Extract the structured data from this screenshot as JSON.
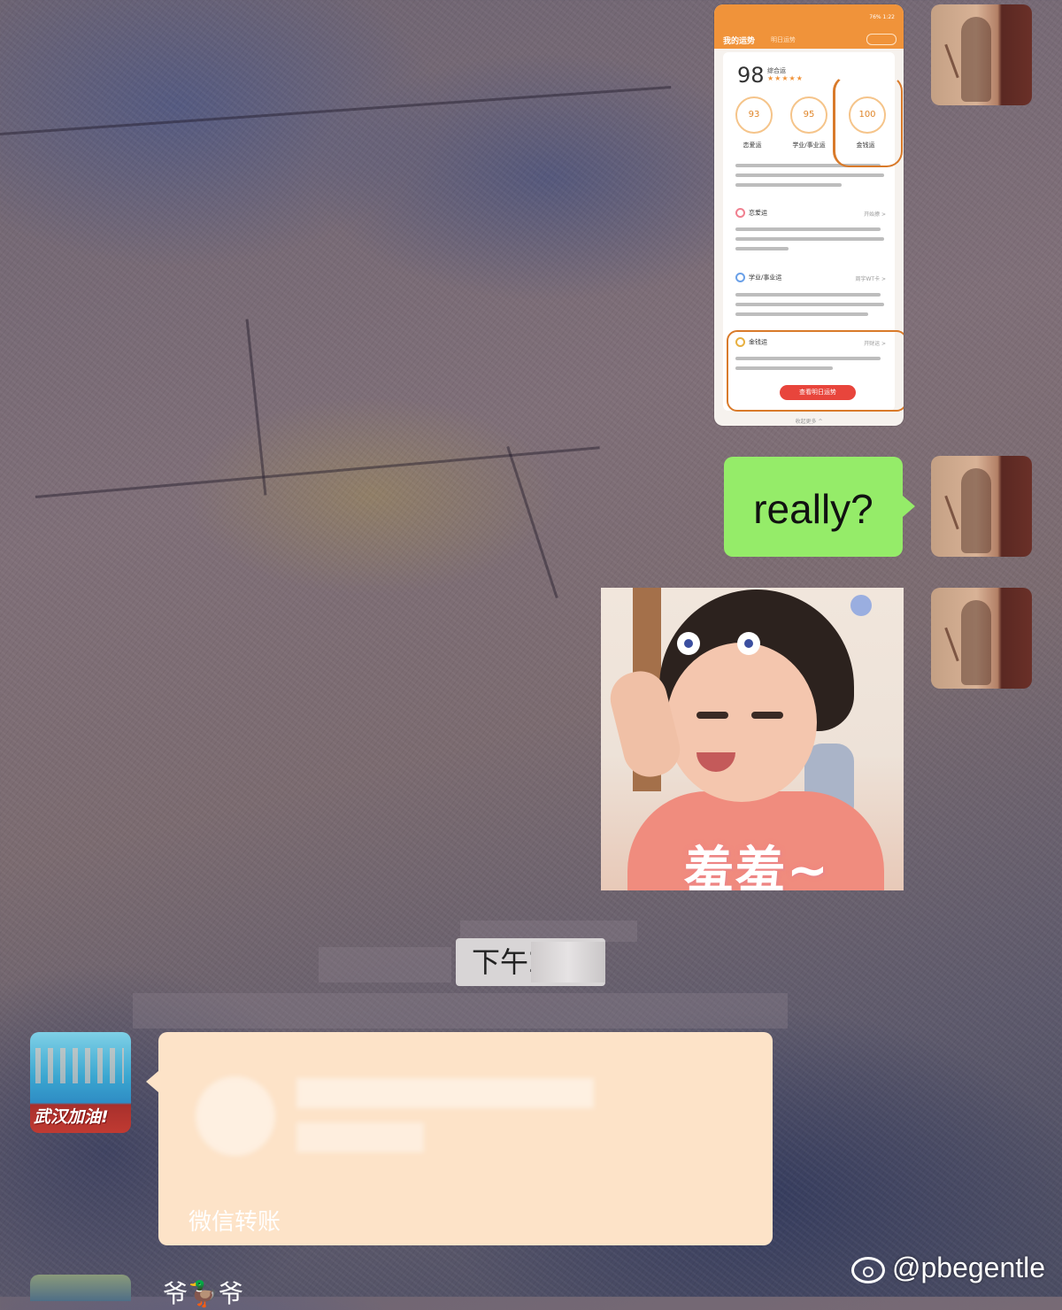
{
  "chat": {
    "screenshot": {
      "status_bar": "76% 1:22",
      "title": "我的运势",
      "tab": "明日运势",
      "score": "98",
      "score_label": "综合运",
      "stars": "★★★★★",
      "rings": [
        {
          "value": "93",
          "label": "恋爱运"
        },
        {
          "value": "95",
          "label": "学业/事业运"
        },
        {
          "value": "100",
          "label": "金钱运"
        }
      ],
      "sections": [
        {
          "title": "恋爱运",
          "more": "开始撩 >"
        },
        {
          "title": "学业/事业运",
          "more": "周宇WT卡 >"
        },
        {
          "title": "金钱运",
          "more": "开财运 >"
        }
      ],
      "button": "查看明日运势",
      "footer": "收起更多 ^"
    },
    "text_message": "really?",
    "sticker_caption": "羞羞~",
    "timestamp": "下午2:…",
    "transfer": {
      "label": "微信转账"
    },
    "left_avatar_badge": "武汉加油!",
    "bottom_sender": "爷🦆爷",
    "watermark": "@pbegentle"
  },
  "icons": {
    "weibo": "weibo-logo-icon"
  },
  "colors": {
    "bubble_green": "#95ec69",
    "transfer_bg": "#fde3c8",
    "screenshot_orange": "#f0933a",
    "button_red": "#e8453c"
  }
}
